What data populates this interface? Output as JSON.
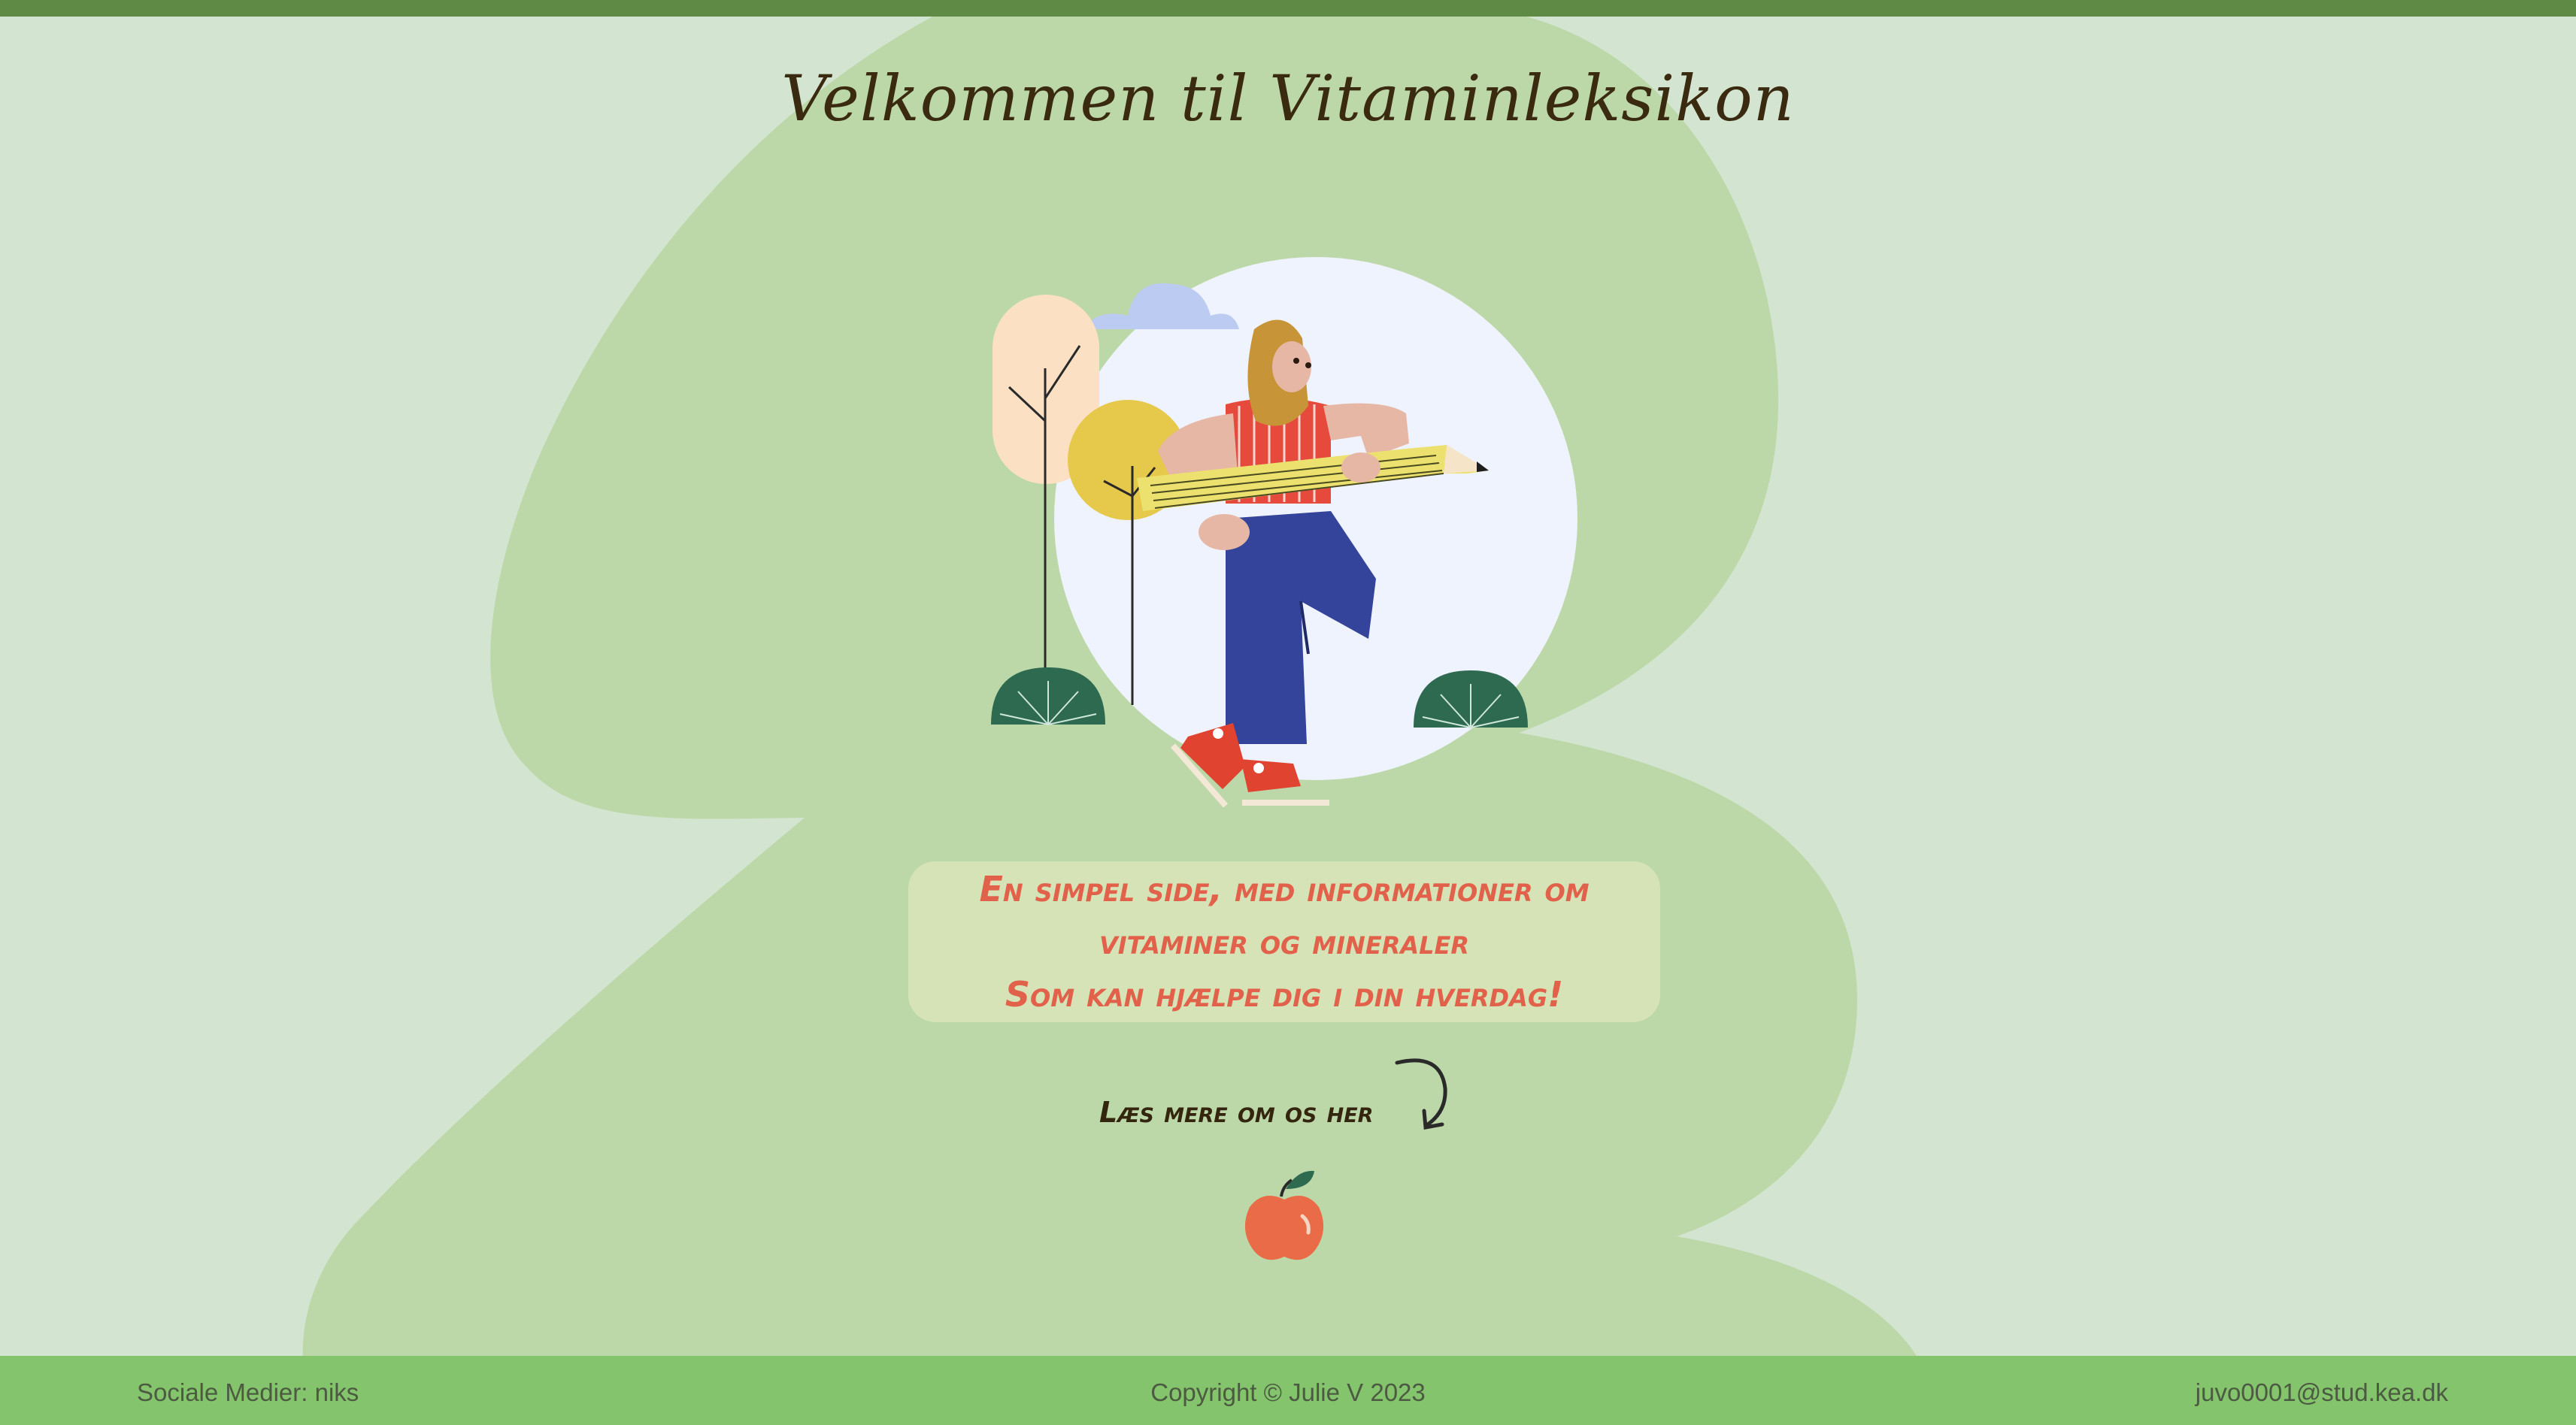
{
  "page": {
    "title": "Velkommen til Vitaminleksikon"
  },
  "info": {
    "lines": [
      "En simpel side, med informationer om",
      "vitaminer og mineraler",
      "Som kan hjælpe dig i din hverdag!"
    ]
  },
  "read_more": {
    "label": "Læs mere om os her"
  },
  "footer": {
    "social": "Sociale Medier: niks",
    "copyright": "Copyright © Julie V 2023",
    "email": "juvo0001@stud.kea.dk"
  },
  "colors": {
    "page_background": "#d3e4d0",
    "blob": "#bdd8a8",
    "top_bar": "#5e8a46",
    "footer": "#84c46c",
    "info_box": "#d5e3b6",
    "accent_text": "#e2614a",
    "heading_text": "#3a2a10"
  },
  "icons": {
    "illustration": "woman-with-pencil-illustration",
    "arrow": "curved-arrow-icon",
    "apple": "apple-icon"
  }
}
